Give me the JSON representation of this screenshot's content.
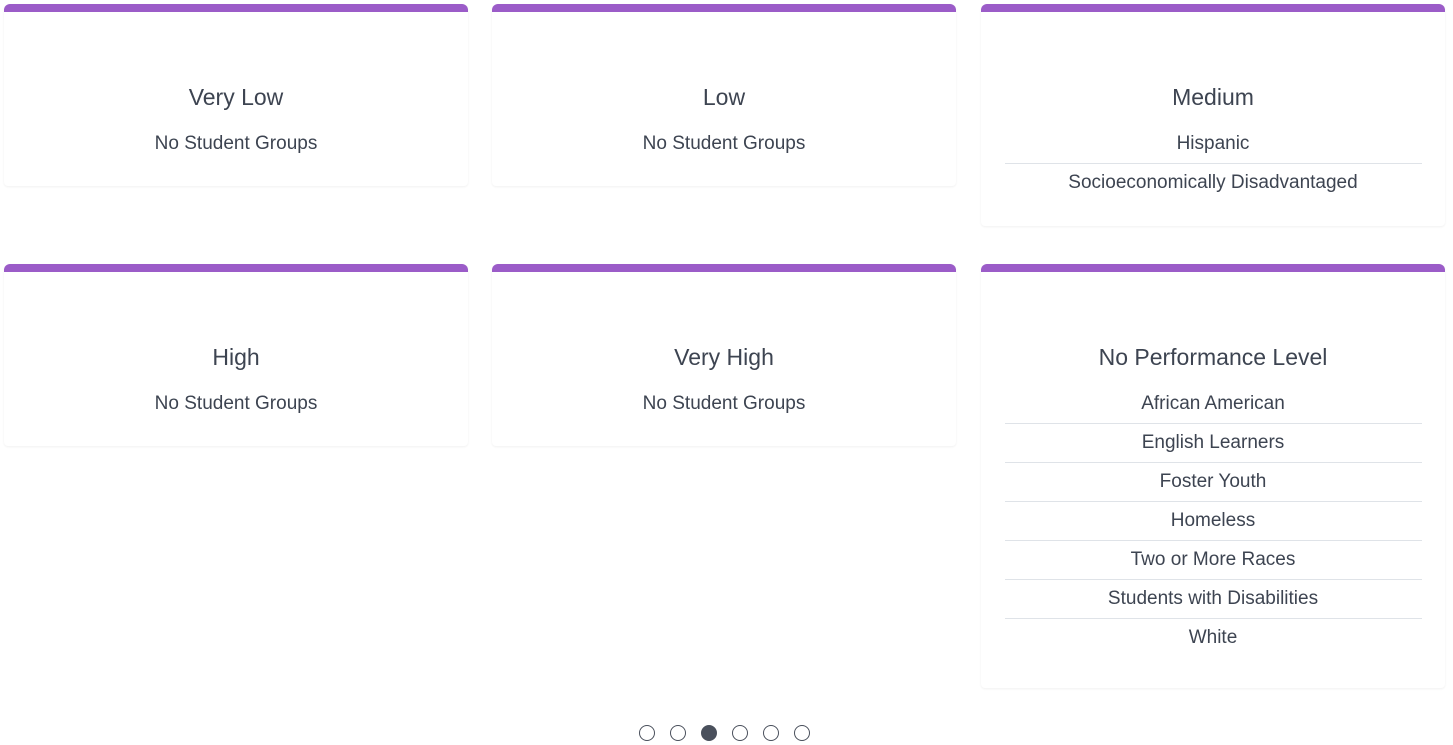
{
  "cards": [
    {
      "title": "Very Low",
      "groups": [
        "No Student Groups"
      ]
    },
    {
      "title": "Low",
      "groups": [
        "No Student Groups"
      ]
    },
    {
      "title": "Medium",
      "groups": [
        "Hispanic",
        "Socioeconomically Disadvantaged"
      ]
    },
    {
      "title": "High",
      "groups": [
        "No Student Groups"
      ]
    },
    {
      "title": "Very High",
      "groups": [
        "No Student Groups"
      ]
    },
    {
      "title": "No Performance Level",
      "groups": [
        "African American",
        "English Learners",
        "Foster Youth",
        "Homeless",
        "Two or More Races",
        "Students with Disabilities",
        "White"
      ]
    }
  ],
  "pagination": {
    "total": 6,
    "active_index": 2
  },
  "colors": {
    "accent_bar": "#9b5cc8",
    "text": "#3d4451",
    "divider": "#dfe3e8",
    "dot": "#4a505c"
  }
}
